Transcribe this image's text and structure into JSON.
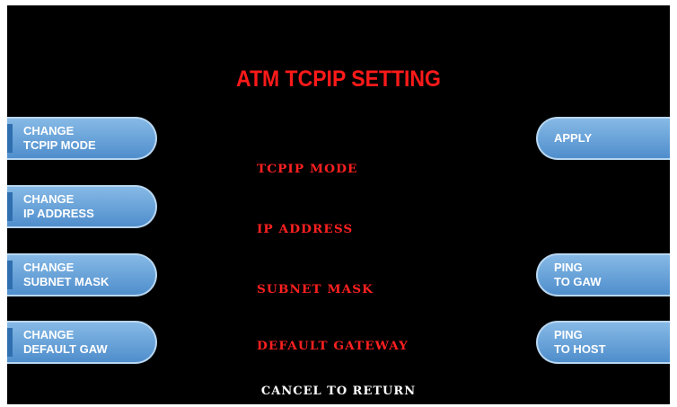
{
  "screen": {
    "title": "ATM TCPIP SETTING",
    "footer": "CANCEL TO RETURN"
  },
  "left_buttons": [
    {
      "line1": "CHANGE",
      "line2": "TCPIP MODE"
    },
    {
      "line1": "CHANGE",
      "line2": "IP ADDRESS"
    },
    {
      "line1": "CHANGE",
      "line2": "SUBNET MASK"
    },
    {
      "line1": "CHANGE",
      "line2": "DEFAULT GAW"
    }
  ],
  "right_buttons": [
    {
      "line1": "APPLY",
      "line2": ""
    },
    {
      "line1": "PING",
      "line2": "TO GAW"
    },
    {
      "line1": "PING",
      "line2": "TO HOST"
    }
  ],
  "fields": [
    {
      "label": "TCPIP MODE"
    },
    {
      "label": "IP ADDRESS"
    },
    {
      "label": "SUBNET MASK"
    },
    {
      "label": "DEFAULT GATEWAY"
    }
  ],
  "colors": {
    "background": "#000000",
    "title": "#ff1a1a",
    "field_label": "#ff2020",
    "button_fill": "#5a97d3",
    "button_text": "#ffffff",
    "footer_text": "#ffffff"
  }
}
